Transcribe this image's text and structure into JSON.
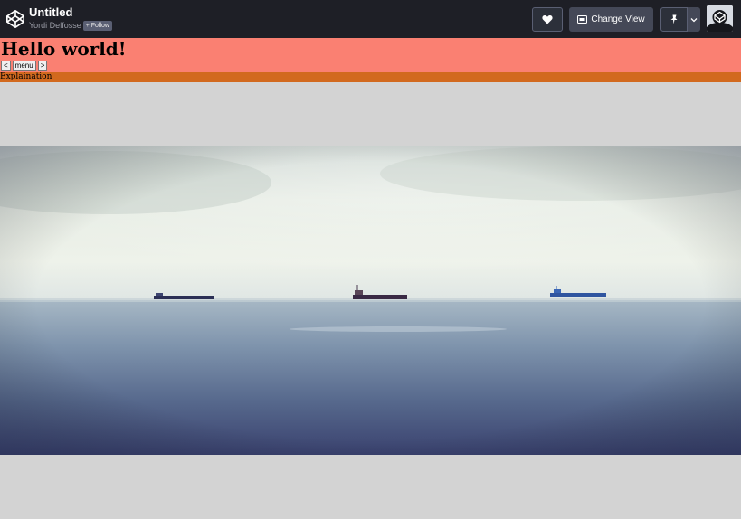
{
  "app": {
    "pen_title": "Untitled",
    "author": "Yordi Delfosse",
    "follow_label": "+ Follow",
    "change_view_label": "Change View",
    "icons": [
      "codepen-logo-icon",
      "heart-icon",
      "layout-icon",
      "pin-icon",
      "chevron-down-icon",
      "avatar"
    ]
  },
  "page": {
    "heading": "Hello world!",
    "nav": {
      "prev_label": "<",
      "menu_label": "menu",
      "next_label": ">"
    },
    "explanation": "Explaination",
    "colors": {
      "header_bg": "#fa8072",
      "explanation_bg": "#d2691e",
      "body_bg": "#d3d3d3"
    }
  }
}
